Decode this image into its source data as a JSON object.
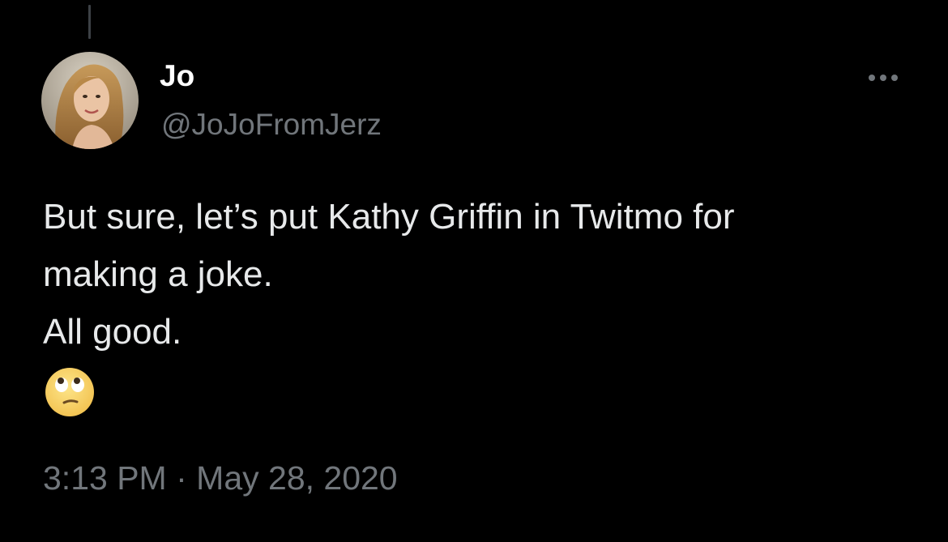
{
  "tweet": {
    "author": {
      "display_name": "Jo",
      "handle": "@JoJoFromJerz",
      "avatar_icon": "profile-photo"
    },
    "more_icon": "ellipsis-icon",
    "text_lines": [
      "But sure, let’s put Kathy Griffin in Twitmo for",
      "making a joke.",
      "All good."
    ],
    "emoji": "🙄",
    "emoji_name": "face-with-rolling-eyes",
    "time": "3:13 PM",
    "separator": "·",
    "date": "May 28, 2020"
  },
  "colors": {
    "background": "#000000",
    "primary_text": "#e7e9ea",
    "secondary_text": "#71767b",
    "thread_line": "#3d4146"
  }
}
